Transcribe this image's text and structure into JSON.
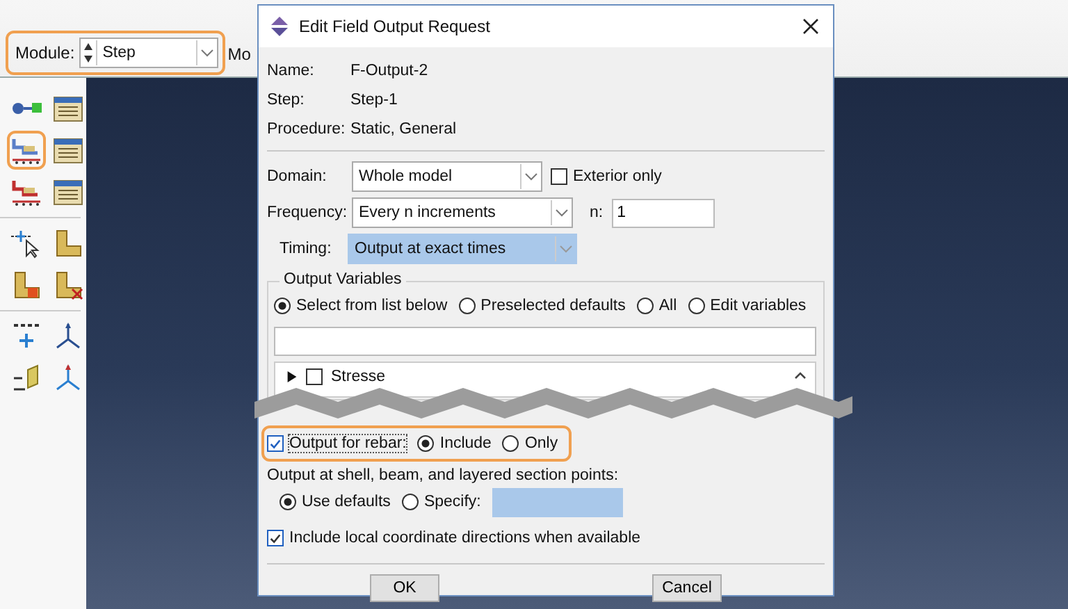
{
  "toolbar": {
    "module": {
      "label": "Module:",
      "value": "Step",
      "highlighted": true
    },
    "next_label": "Mo"
  },
  "toolbox": {
    "groups": [
      [
        {
          "kind": "connector",
          "highlighted": false
        },
        {
          "kind": "manager",
          "highlighted": false
        },
        {
          "kind": "step-chart",
          "highlighted": true
        },
        {
          "kind": "manager",
          "highlighted": false
        },
        {
          "kind": "load-chart",
          "highlighted": false
        },
        {
          "kind": "manager",
          "highlighted": false
        }
      ],
      [
        {
          "kind": "pick",
          "highlighted": false
        },
        {
          "kind": "part",
          "highlighted": false
        },
        {
          "kind": "part-block",
          "highlighted": false
        },
        {
          "kind": "part-cut",
          "highlighted": false
        }
      ],
      [
        {
          "kind": "datum-point",
          "highlighted": false
        },
        {
          "kind": "axes",
          "highlighted": false
        },
        {
          "kind": "datum-plane",
          "highlighted": false
        },
        {
          "kind": "triad",
          "highlighted": false
        }
      ]
    ]
  },
  "dialog": {
    "title": "Edit Field Output Request",
    "info": [
      {
        "label": "Name:",
        "value": "F-Output-2"
      },
      {
        "label": "Step:",
        "value": "Step-1"
      },
      {
        "label": "Procedure:",
        "value": "Static, General"
      }
    ],
    "domain": {
      "label": "Domain:",
      "value": "Whole model"
    },
    "exterior_only": {
      "label": "Exterior only",
      "checked": false
    },
    "frequency": {
      "label": "Frequency:",
      "value": "Every n increments"
    },
    "n": {
      "label": "n:",
      "value": "1"
    },
    "timing": {
      "label": "Timing:",
      "value": "Output at exact times"
    },
    "output_variables": {
      "title": "Output Variables",
      "options": [
        {
          "label": "Select from list below",
          "selected": true
        },
        {
          "label": "Preselected defaults",
          "selected": false
        },
        {
          "label": "All",
          "selected": false
        },
        {
          "label": "Edit variables",
          "selected": false
        }
      ],
      "tree": [
        {
          "label": "Stresse",
          "checked": false,
          "expanded": false
        }
      ]
    },
    "rebar": {
      "label": "Output for rebar:",
      "checked": true,
      "highlighted": true,
      "options": [
        {
          "label": "Include",
          "selected": true
        },
        {
          "label": "Only",
          "selected": false
        }
      ]
    },
    "section_points": {
      "label": "Output at shell, beam, and layered section points:",
      "options": [
        {
          "label": "Use defaults",
          "selected": true
        },
        {
          "label": "Specify:",
          "selected": false
        }
      ]
    },
    "local_coords": {
      "label": "Include local coordinate directions when available",
      "checked": true
    },
    "buttons": [
      "OK",
      "Cancel"
    ]
  }
}
